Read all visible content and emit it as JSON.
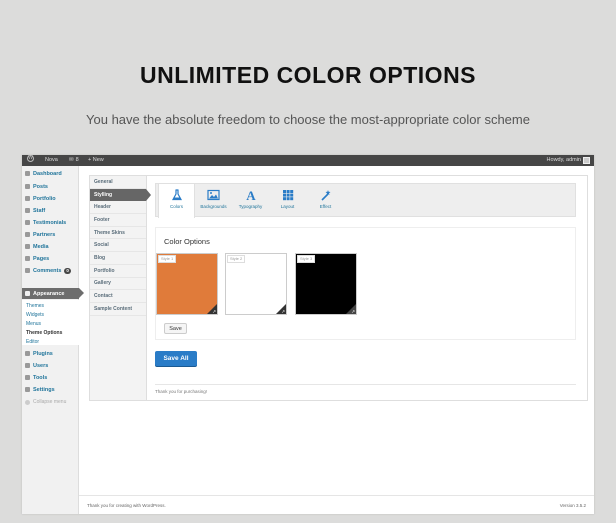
{
  "hero": {
    "title": "UNLIMITED COLOR OPTIONS",
    "subtitle": "You have the absolute freedom to choose the most-appropriate color scheme"
  },
  "adminbar": {
    "site_name": "Nova",
    "comments_count": "8",
    "new_label": "+ New",
    "greeting": "Howdy, admin"
  },
  "sidebar": {
    "items": [
      {
        "label": "Dashboard",
        "icon": "dashboard-icon"
      },
      {
        "label": "Posts",
        "icon": "pin-icon"
      },
      {
        "label": "Portfolio",
        "icon": "pin-icon"
      },
      {
        "label": "Staff",
        "icon": "pin-icon"
      },
      {
        "label": "Testimonials",
        "icon": "pin-icon"
      },
      {
        "label": "Partners",
        "icon": "pin-icon"
      },
      {
        "label": "Media",
        "icon": "media-icon"
      },
      {
        "label": "Pages",
        "icon": "pages-icon"
      },
      {
        "label": "Comments",
        "icon": "comments-icon",
        "badge": "0"
      },
      {
        "label": "Appearance",
        "icon": "appearance-icon"
      },
      {
        "label": "Plugins",
        "icon": "plugins-icon"
      },
      {
        "label": "Users",
        "icon": "users-icon"
      },
      {
        "label": "Tools",
        "icon": "tools-icon"
      },
      {
        "label": "Settings",
        "icon": "settings-icon"
      }
    ],
    "submenu": [
      "Themes",
      "Widgets",
      "Menus",
      "Theme Options",
      "Editor"
    ],
    "collapse_label": "Collapse menu"
  },
  "options_nav": {
    "tabs": [
      "General",
      "Stylling",
      "Header",
      "Footer",
      "Theme Skins",
      "Social",
      "Blog",
      "Portfolio",
      "Gallery",
      "Contact",
      "Sample Content"
    ]
  },
  "style_tabs": [
    {
      "label": "Colors",
      "icon": "flask-icon"
    },
    {
      "label": "Backgrounds",
      "icon": "image-icon"
    },
    {
      "label": "Typography",
      "icon": "typography-icon"
    },
    {
      "label": "Layout",
      "icon": "grid-icon"
    },
    {
      "label": "Effect",
      "icon": "magic-wand-icon"
    }
  ],
  "color_options": {
    "title": "Color Options",
    "styles": [
      {
        "label": "Style 1",
        "color": "#e07b3a"
      },
      {
        "label": "Style 2",
        "color": "#ffffff"
      },
      {
        "label": "Style 3",
        "color": "#000000"
      }
    ],
    "save_label": "Save"
  },
  "save_all_label": "Save All",
  "thanks_text": "Thank you for purchasing!",
  "footer": {
    "left": "Thank you for creating with WordPress.",
    "right": "Version 3.5.2"
  },
  "colors": {
    "accent": "#21759b",
    "primary_button": "#2a7cc7",
    "admin_bar": "#464646"
  }
}
